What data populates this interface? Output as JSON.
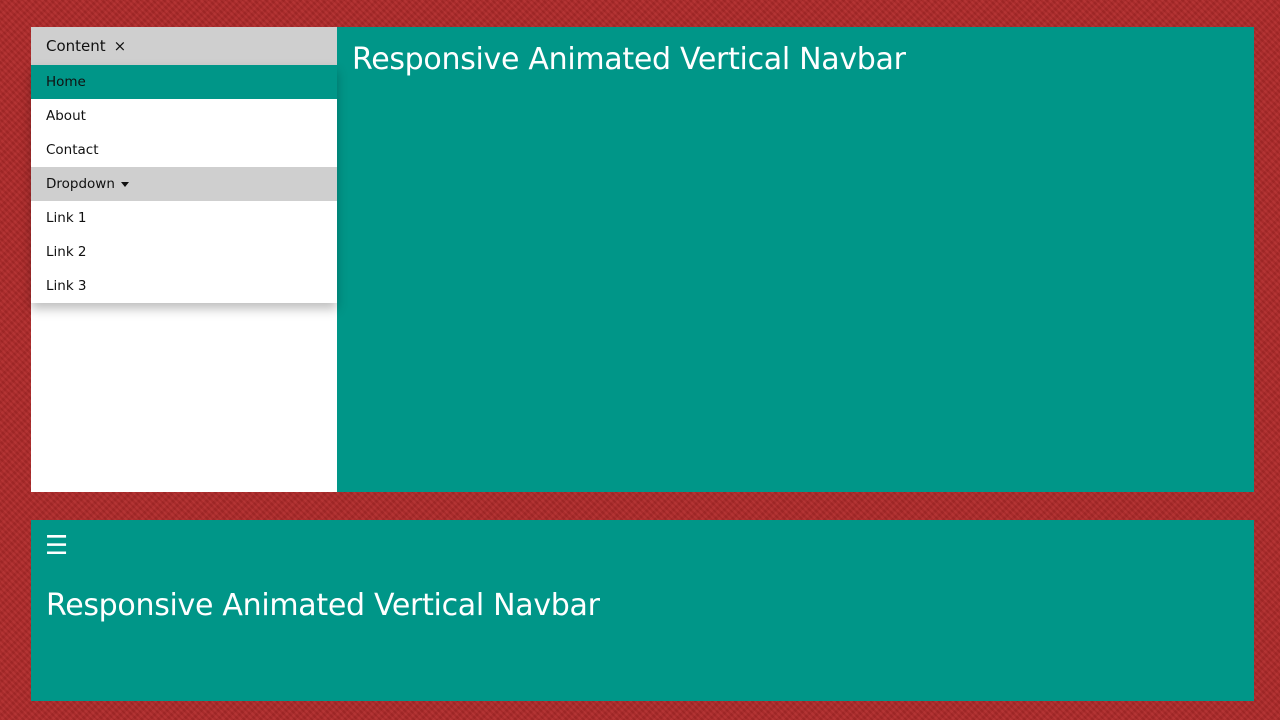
{
  "top": {
    "sidebar": {
      "header_label": "Content",
      "close_symbol": "×",
      "items": [
        {
          "label": "Home",
          "active": true
        },
        {
          "label": "About"
        },
        {
          "label": "Contact"
        }
      ],
      "dropdown": {
        "label": "Dropdown",
        "links": [
          "Link 1",
          "Link 2",
          "Link 3"
        ]
      }
    },
    "title": "Responsive Animated Vertical Navbar"
  },
  "bottom": {
    "menu_icon": "☰",
    "title": "Responsive Animated Vertical Navbar"
  },
  "colors": {
    "accent": "#009688",
    "background": "#b02a2a",
    "sidebar_header": "#cfcfcf"
  }
}
